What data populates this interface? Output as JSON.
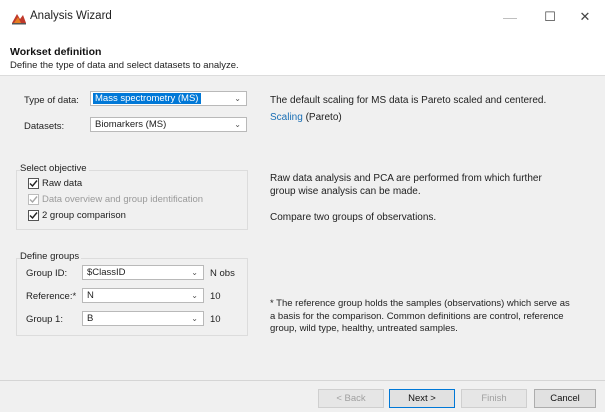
{
  "window": {
    "title": "Analysis Wizard",
    "minimize_glyph": "—",
    "maximize_glyph": "☐",
    "close_glyph": "✕"
  },
  "header": {
    "title": "Workset definition",
    "subtitle": "Define the type of data and select datasets to analyze."
  },
  "data_selection": {
    "type_label": "Type of data:",
    "type_value": "Mass spectrometry (MS)",
    "datasets_label": "Datasets:",
    "datasets_value": "Biomarkers (MS)",
    "scaling_info": "The default scaling for MS data is Pareto scaled and centered.",
    "scaling_link": "Scaling",
    "scaling_value": "(Pareto)"
  },
  "objective": {
    "title": "Select objective",
    "items": [
      {
        "label": "Raw data",
        "checked": true,
        "disabled": false
      },
      {
        "label": "Data overview and group identification",
        "checked": true,
        "disabled": true
      },
      {
        "label": "2 group comparison",
        "checked": true,
        "disabled": false
      }
    ],
    "info_raw": "Raw data analysis and PCA are performed from which further group wise analysis can be made.",
    "info_compare": "Compare two groups of observations."
  },
  "groups": {
    "title": "Define groups",
    "group_id_label": "Group ID:",
    "group_id_value": "$ClassID",
    "group_id_suffix": "N obs",
    "reference_label": "Reference:*",
    "reference_value": "N",
    "reference_count": "10",
    "group1_label": "Group 1:",
    "group1_value": "B",
    "group1_count": "10",
    "note": "* The reference group holds the samples (observations) which serve as a basis for the comparison. Common definitions are control, reference group, wild type, healthy, untreated samples."
  },
  "footer": {
    "back_label": "< Back",
    "next_label": "Next >",
    "finish_label": "Finish",
    "cancel_label": "Cancel"
  },
  "colors": {
    "accent": "#0078d7",
    "link": "#1a6fb5",
    "background": "#f0f0f0"
  }
}
